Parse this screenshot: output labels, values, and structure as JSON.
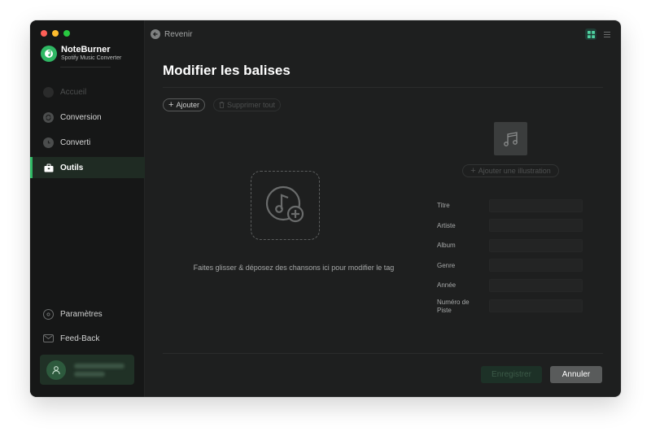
{
  "app": {
    "name": "NoteBurner",
    "subtitle": "Spotify Music Converter"
  },
  "sidebar": {
    "items": [
      {
        "label": "Accueil",
        "icon": "home-icon",
        "state": "disabled"
      },
      {
        "label": "Conversion",
        "icon": "convert-icon",
        "state": "normal"
      },
      {
        "label": "Converti",
        "icon": "clock-icon",
        "state": "normal"
      },
      {
        "label": "Outils",
        "icon": "toolbox-icon",
        "state": "active"
      }
    ],
    "bottom_items": [
      {
        "label": "Paramètres",
        "icon": "gear-icon"
      },
      {
        "label": "Feed-Back",
        "icon": "mail-icon"
      }
    ]
  },
  "header": {
    "back_label": "Revenir"
  },
  "main": {
    "title": "Modifier les balises",
    "add_label": "Ajouter",
    "delete_all_label": "Supprimer tout",
    "drop_text": "Faites glisser & déposez des chansons ici pour modifier le tag",
    "add_art_label": "Ajouter une illustration",
    "fields": [
      {
        "label": "Titre",
        "value": ""
      },
      {
        "label": "Artiste",
        "value": ""
      },
      {
        "label": "Album",
        "value": ""
      },
      {
        "label": "Genre",
        "value": ""
      },
      {
        "label": "Année",
        "value": ""
      },
      {
        "label": "Numéro de Piste",
        "value": ""
      }
    ],
    "save_label": "Enregistrer",
    "cancel_label": "Annuler"
  },
  "colors": {
    "accent": "#2fb864",
    "background": "#1e1f1f",
    "sidebar": "#161717"
  }
}
